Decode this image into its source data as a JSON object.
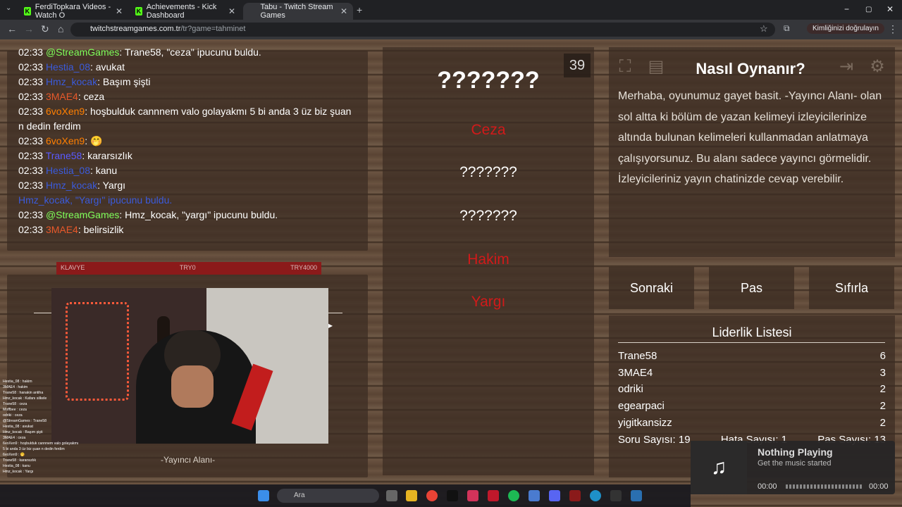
{
  "browser": {
    "tabs": [
      {
        "title": "FerdiTopkara Videos - Watch O",
        "fav_color": "#53fc18"
      },
      {
        "title": "Achievements - Kick Dashboard",
        "fav_color": "#53fc18"
      },
      {
        "title": "Tabu - Twitch Stream Games",
        "fav_color": "#5c8cff"
      }
    ],
    "new_tab": "+",
    "url_domain": "twitchstreamgames.com.tr",
    "url_path": "/tr?game=tahminet",
    "profile_label": "Kimliğinizi doğrulayın",
    "minimize": "−",
    "restore": "▢",
    "close": "✕"
  },
  "chat": {
    "lines": [
      {
        "time": "02:33",
        "user": "@StreamGames",
        "user_color": "#7fff5a",
        "msg": ": Trane58, \"ceza\" ipucunu buldu."
      },
      {
        "time": "02:33",
        "user": "Hestia_08",
        "user_color": "#3b5bdb",
        "msg": ": avukat"
      },
      {
        "time": "02:33",
        "user": "Hmz_kocak",
        "user_color": "#3b5bdb",
        "msg": ": Başım şişti"
      },
      {
        "time": "02:33",
        "user": "3MAE4",
        "user_color": "#e8582a",
        "msg": ": ceza"
      },
      {
        "time": "02:33",
        "user": "6voXen9",
        "user_color": "#ff7f00",
        "msg": ": hoşbulduk cannnem valo golayakmı 5 bi anda 3 üz biz şuan n dedin ferdim",
        "wrap": true
      },
      {
        "time": "02:33",
        "user": "6voXen9",
        "user_color": "#ff7f00",
        "msg": ": 🤭"
      },
      {
        "time": "02:33",
        "user": "Trane58",
        "user_color": "#5a5aff",
        "msg": ": kararsızlık"
      },
      {
        "time": "02:33",
        "user": "Hestia_08",
        "user_color": "#3b5bdb",
        "msg": ": kanu"
      },
      {
        "time": "02:33",
        "user": "Hmz_kocak",
        "user_color": "#3b5bdb",
        "msg": ": Yargı"
      },
      {
        "time": "",
        "user": "Hmz_kocak, ",
        "user_color": "#3b5bdb",
        "msg": "\"Yargı\" ipucunu buldu.",
        "msg_color": "#3b5bdb",
        "notice": true
      },
      {
        "time": "02:33",
        "user": "@StreamGames",
        "user_color": "#7fff5a",
        "msg": ": Hmz_kocak, \"yargı\" ipucunu buldu."
      },
      {
        "time": "02:33",
        "user": "3MAE4",
        "user_color": "#e8582a",
        "msg": ": belirsizlik"
      }
    ]
  },
  "card": {
    "hidden_word": "???????",
    "timer": "39",
    "taboo_words": [
      {
        "text": "Ceza",
        "color": "#d11a1a"
      },
      {
        "text": "???????",
        "color": "#ffffff"
      },
      {
        "text": "???????",
        "color": "#ffffff"
      },
      {
        "text": "Hakim",
        "color": "#d11a1a"
      },
      {
        "text": "Yargı",
        "color": "#d11a1a"
      }
    ]
  },
  "rules": {
    "title": "Nasıl Oynanır?",
    "text": "Merhaba, oyunumuz gayet basit. -Yayıncı Alanı- olan sol altta ki bölüm de yazan kelimeyi izleyicilerinize altında bulunan kelimeleri kullanmadan anlatmaya çalışıyorsunuz. Bu alanı sadece yayıncı görmelidir. İzleyicileriniz yayın chatinizde cevap verebilir."
  },
  "controls": {
    "next": "Sonraki",
    "pass": "Pas",
    "reset": "Sıfırla"
  },
  "leaderboard": {
    "title": "Liderlik Listesi",
    "rows": [
      {
        "name": "Trane58",
        "score": "6"
      },
      {
        "name": "3MAE4",
        "score": "3"
      },
      {
        "name": "odriki",
        "score": "2"
      },
      {
        "name": "egearpaci",
        "score": "2"
      },
      {
        "name": "yigitkansizz",
        "score": "2"
      }
    ],
    "question_count": "Soru Sayısı: 19",
    "error_count": "Hata Sayısı: 1",
    "pass_count": "Pas Sayısı: 13"
  },
  "overlay": {
    "keyboard_bar": {
      "left": "KLAVYE",
      "mid": "TRY0",
      "right": "TRY4000"
    },
    "streamer_area": "-Yayıncı Alanı-"
  },
  "mini_chat": [
    "Hestia_08 : hakim",
    "3MAE4 : hakim",
    "Trane58 : hanakin antiha",
    "Hmz_kocak : Kafanı silkele",
    "Trane58 : ceza",
    "Moffbee : ceza",
    "odriki : ceza",
    "@StreamGames : Trane58",
    "Hestia_08 : avukat",
    "Hmz_kocak : Başım şişti",
    "3MAE4 : ceza",
    "6voXen9 : hoşbulduk cannnem valo golayakmı 5 bi anda 3 üz biz şuan n dedin ferdim",
    "6voXen9 : 🤭",
    "Trane58 : kararsızlık",
    "Hestia_08 : kanu",
    "Hmz_kocak : Yargı"
  ],
  "taskbar": {
    "search_placeholder": "Ara"
  },
  "music": {
    "title": "Nothing Playing",
    "subtitle": "Get the music started",
    "time_start": "00:00",
    "time_end": "00:00"
  }
}
